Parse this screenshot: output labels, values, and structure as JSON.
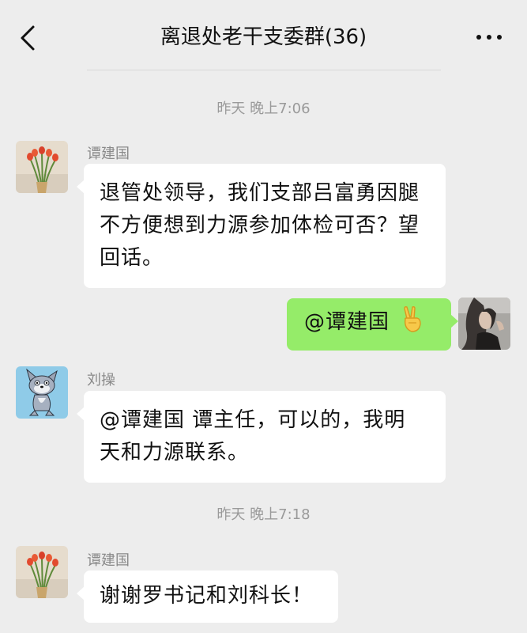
{
  "header": {
    "title": "离退处老干支委群(36)",
    "back_icon": "chevron-left-icon",
    "more_icon": "more-dots-icon"
  },
  "messages": [
    {
      "type": "time",
      "text": "昨天 晚上7:06"
    },
    {
      "type": "message",
      "side": "left",
      "sender": "谭建国",
      "avatar": "tulip-avatar",
      "lines": [
        "退管处领导，我们支部吕富勇因腿",
        "不方便想到力源参加体检可否？望",
        "回话。"
      ]
    },
    {
      "type": "message",
      "side": "right",
      "avatar": "woman-photo-avatar",
      "text": "@谭建国",
      "emoji": "victory-hand-emoji"
    },
    {
      "type": "message",
      "side": "left",
      "sender": "刘操",
      "avatar": "cartoon-cat-avatar",
      "lines": [
        "@谭建国  谭主任，可以的，我明",
        "天和力源联系。"
      ]
    },
    {
      "type": "time",
      "text": "昨天 晚上7:18"
    },
    {
      "type": "message",
      "side": "left",
      "sender": "谭建国",
      "avatar": "tulip-avatar",
      "lines": [
        "谢谢罗书记和刘科长！"
      ]
    }
  ],
  "colors": {
    "background": "#ededed",
    "bubble_self": "#95ec69",
    "bubble_other": "#ffffff"
  }
}
